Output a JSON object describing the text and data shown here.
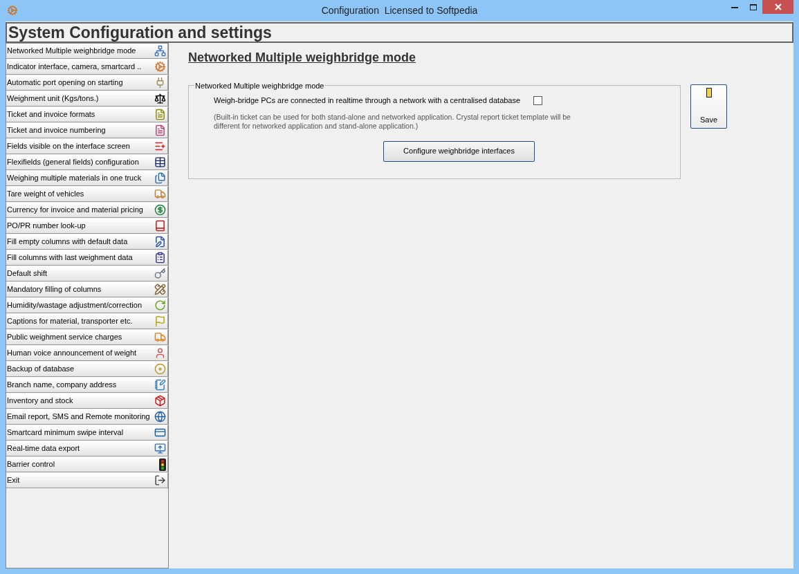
{
  "window": {
    "title": "Configuration  Licensed to Softpedia"
  },
  "header": {
    "title": "System Configuration and settings"
  },
  "sidebar": {
    "items": [
      {
        "label": "Networked Multiple weighbridge mode"
      },
      {
        "label": "Indicator interface, camera, smartcard .."
      },
      {
        "label": "Automatic port opening on starting"
      },
      {
        "label": "Weighment unit (Kgs/tons.)"
      },
      {
        "label": "Ticket and invoice formats"
      },
      {
        "label": "Ticket and invoice numbering"
      },
      {
        "label": "Fields visible on the interface screen"
      },
      {
        "label": "Flexifields (general fields) configuration"
      },
      {
        "label": "Weighing multiple materials in one truck"
      },
      {
        "label": "Tare weight of vehicles"
      },
      {
        "label": "Currency for invoice and material pricing"
      },
      {
        "label": "PO/PR number look-up"
      },
      {
        "label": "Fill empty columns with default data"
      },
      {
        "label": "Fill columns with last weighment data"
      },
      {
        "label": "Default shift"
      },
      {
        "label": "Mandatory filling of columns"
      },
      {
        "label": "Humidity/wastage adjustment/correction"
      },
      {
        "label": "Captions for material, transporter etc."
      },
      {
        "label": "Public weighment service charges"
      },
      {
        "label": "Human voice announcement of weight"
      },
      {
        "label": "Backup of database"
      },
      {
        "label": "Branch name, company address"
      },
      {
        "label": "Inventory and stock"
      },
      {
        "label": "Email report, SMS and Remote monitoring"
      },
      {
        "label": "Smartcard minimum swipe interval"
      },
      {
        "label": "Real-time data export"
      },
      {
        "label": "Barrier control"
      },
      {
        "label": "Exit"
      }
    ]
  },
  "content": {
    "title": "Networked Multiple weighbridge mode",
    "group": {
      "legend": "Networked Multiple weighbridge mode",
      "option": {
        "label": "Weigh-bridge PCs are connected in realtime through a network with a centralised database",
        "checked": false
      },
      "note": "(Built-in ticket can be used for both stand-alone and networked application. Crystal report ticket template will be different for networked application and stand-alone application.)",
      "button": "Configure weighbridge interfaces"
    },
    "save_button": "Save"
  }
}
